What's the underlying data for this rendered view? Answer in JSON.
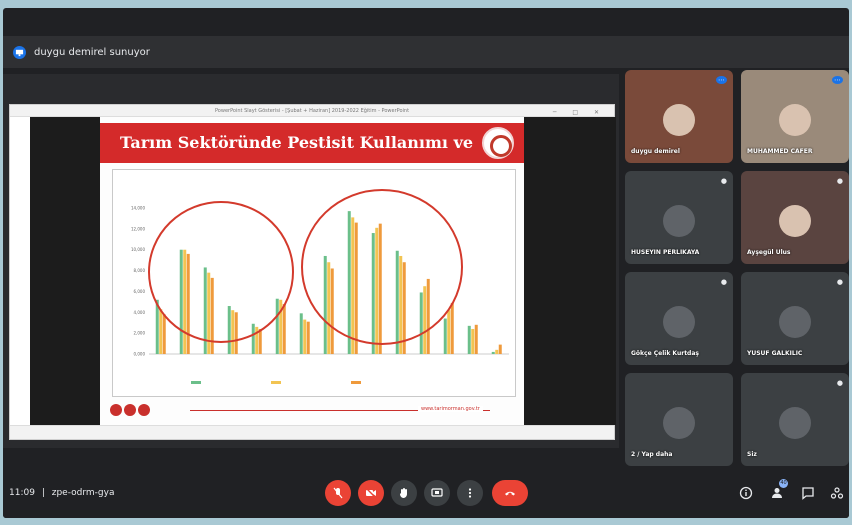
{
  "presenter": {
    "label": "duygu demirel sunuyor"
  },
  "slide": {
    "window_title": "PowerPoint Slayt Gösterisi - [Şubat + Haziran] 2019-2022 Eğitim - PowerPoint",
    "title": "Tarım Sektöründe Pestisit Kullanımı ve Riskler",
    "footer_text": "www.tarimorman.gov.tr"
  },
  "chart_data": {
    "type": "bar",
    "title": "",
    "subtitle": "",
    "xlabel": "",
    "ylabel": "",
    "ylim": [
      0,
      14000
    ],
    "y_ticks": [
      "0,000",
      "2,000",
      "4,000",
      "6,000",
      "8,000",
      "10,000",
      "12,000",
      "14,000"
    ],
    "categories": [
      "",
      "",
      "",
      "",
      "",
      "",
      "",
      "",
      "",
      "",
      "",
      "",
      "",
      "",
      ""
    ],
    "series": [
      {
        "values": [
          5200,
          10000,
          8300,
          4600,
          2900,
          5300,
          3900,
          9400,
          13700,
          11600,
          9900,
          5900,
          3400,
          2700,
          200
        ]
      },
      {
        "values": [
          4300,
          10000,
          7800,
          4200,
          2600,
          5200,
          3300,
          8800,
          13100,
          12100,
          9400,
          6500,
          4200,
          2400,
          400
        ]
      },
      {
        "values": [
          3800,
          9600,
          7300,
          4000,
          2400,
          4800,
          3100,
          8200,
          12600,
          12500,
          8800,
          7200,
          4900,
          2800,
          900
        ]
      }
    ],
    "colors": [
      "#6bbf8a",
      "#f2c452",
      "#ef9a3c"
    ],
    "legend_position": "bottom",
    "grid": false
  },
  "tiles": [
    {
      "name": "duygu demirel",
      "color": "#7a4a3a",
      "status": "more"
    },
    {
      "name": "MUHAMMED CAFER",
      "color": "#9a8a7a",
      "status": "more"
    },
    {
      "name": "HUSEYIN PERLIKAYA",
      "color": "#3c4043",
      "status": "muted"
    },
    {
      "name": "Ayşegül Ulus",
      "color": "#5a4440",
      "status": "muted"
    },
    {
      "name": "Gökçe Çelik Kurtdaş",
      "color": "#3c4043",
      "status": "muted"
    },
    {
      "name": "YUSUF GALKILIC",
      "color": "#3c4043",
      "status": "muted"
    },
    {
      "name": "2 / Yap daha",
      "color": "#3c4043",
      "status": ""
    },
    {
      "name": "Siz",
      "color": "#3c4043",
      "status": "muted"
    }
  ],
  "meeting": {
    "time": "11:09",
    "code": "zpe-odrm-gya",
    "separator": "|"
  },
  "controls": [
    "mic-off",
    "camera-off",
    "raise-hand",
    "present",
    "more-options",
    "leave-call"
  ],
  "right_controls": [
    "info",
    "people",
    "chat",
    "activities"
  ],
  "people_count": "40"
}
